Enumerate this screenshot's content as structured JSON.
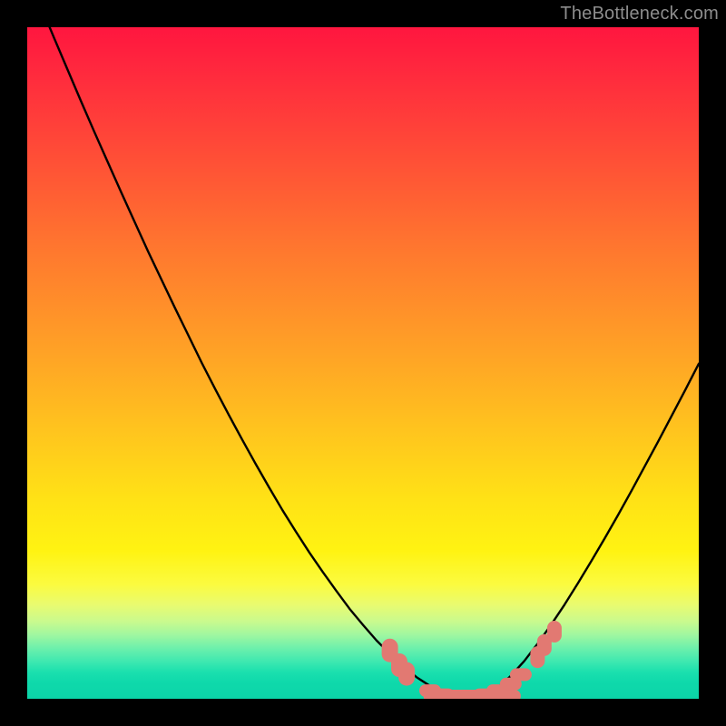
{
  "watermark": "TheBottleneck.com",
  "chart_data": {
    "type": "line",
    "title": "",
    "xlabel": "",
    "ylabel": "",
    "x": [
      0.0,
      0.02,
      0.04,
      0.06,
      0.08,
      0.1,
      0.12,
      0.14,
      0.16,
      0.18,
      0.2,
      0.22,
      0.24,
      0.26,
      0.28,
      0.3,
      0.32,
      0.34,
      0.36,
      0.38,
      0.4,
      0.42,
      0.44,
      0.46,
      0.48,
      0.5,
      0.52,
      0.54,
      0.56,
      0.58,
      0.6,
      0.62,
      0.64,
      0.66,
      0.68,
      0.7,
      0.72,
      0.74,
      0.76,
      0.78,
      0.8,
      0.82,
      0.84,
      0.86,
      0.88,
      0.9,
      0.92,
      0.94,
      0.96,
      0.98,
      1.0
    ],
    "y": [
      1.08,
      1.032,
      0.984,
      0.937,
      0.89,
      0.844,
      0.799,
      0.754,
      0.71,
      0.666,
      0.624,
      0.582,
      0.541,
      0.5,
      0.461,
      0.423,
      0.386,
      0.35,
      0.315,
      0.281,
      0.249,
      0.218,
      0.189,
      0.161,
      0.134,
      0.11,
      0.087,
      0.067,
      0.048,
      0.032,
      0.019,
      0.009,
      0.003,
      0.0,
      0.004,
      0.016,
      0.034,
      0.056,
      0.082,
      0.11,
      0.14,
      0.172,
      0.205,
      0.239,
      0.274,
      0.31,
      0.347,
      0.384,
      0.422,
      0.46,
      0.499
    ],
    "xlim": [
      0,
      1
    ],
    "ylim": [
      0,
      1
    ],
    "grid": false,
    "series_color": "#000000",
    "markers": {
      "color": "#e27972",
      "shape": "rounded-blob",
      "points_xy": [
        [
          0.54,
          0.072
        ],
        [
          0.554,
          0.05
        ],
        [
          0.565,
          0.037
        ],
        [
          0.6,
          0.012
        ],
        [
          0.62,
          0.006
        ],
        [
          0.64,
          0.003
        ],
        [
          0.66,
          0.003
        ],
        [
          0.68,
          0.006
        ],
        [
          0.7,
          0.012
        ],
        [
          0.72,
          0.022
        ],
        [
          0.735,
          0.036
        ],
        [
          0.76,
          0.062
        ],
        [
          0.77,
          0.08
        ],
        [
          0.785,
          0.1
        ]
      ]
    },
    "background_gradient_stops": [
      {
        "pos": 0.0,
        "hex": "#ff163f"
      },
      {
        "pos": 0.34,
        "hex": "#ff7a2e"
      },
      {
        "pos": 0.7,
        "hex": "#ffe116"
      },
      {
        "pos": 0.86,
        "hex": "#e9fb70"
      },
      {
        "pos": 1.0,
        "hex": "#0bd4a8"
      }
    ]
  }
}
